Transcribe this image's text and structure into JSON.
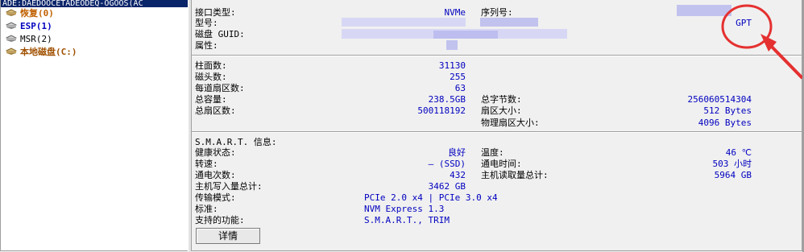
{
  "tree": {
    "top_text": "ADE:DAEDOOCETADEODEQ-OGOOS(AC",
    "items": [
      {
        "label": "恢复(0)",
        "color": "orange"
      },
      {
        "label": "ESP(1)",
        "color": "blue"
      },
      {
        "label": "MSR(2)",
        "color": "black"
      },
      {
        "label": "本地磁盘(C:)",
        "color": "brown"
      }
    ]
  },
  "info": {
    "interface_label": "接口类型:",
    "interface_value": "NVMe",
    "serial_label": "序列号:",
    "model_label": "型号:",
    "partition_style_value": "GPT",
    "guid_label": "磁盘 GUID:",
    "attr_label": "属性:",
    "cylinders_label": "柱面数:",
    "cylinders_value": "31130",
    "heads_label": "磁头数:",
    "heads_value": "255",
    "sectors_per_track_label": "每道扇区数:",
    "sectors_per_track_value": "63",
    "capacity_label": "总容量:",
    "capacity_value": "238.5GB",
    "total_bytes_label": "总字节数:",
    "total_bytes_value": "256060514304",
    "total_sectors_label": "总扇区数:",
    "total_sectors_value": "500118192",
    "sector_size_label": "扇区大小:",
    "sector_size_value": "512 Bytes",
    "physical_sector_label": "物理扇区大小:",
    "physical_sector_value": "4096 Bytes"
  },
  "smart": {
    "title": "S.M.A.R.T. 信息:",
    "health_label": "健康状态:",
    "health_value": "良好",
    "temp_label": "温度:",
    "temp_value": "46 ℃",
    "speed_label": "转速:",
    "speed_value": "— (SSD)",
    "power_on_time_label": "通电时间:",
    "power_on_time_value": "503 小时",
    "power_count_label": "通电次数:",
    "power_count_value": "432",
    "host_read_label": "主机读取量总计:",
    "host_read_value": "5964 GB",
    "host_write_label": "主机写入量总计:",
    "host_write_value": "3462 GB",
    "transfer_label": "传输模式:",
    "transfer_value": "PCIe 2.0 x4 | PCIe 3.0 x4",
    "standard_label": "标准:",
    "standard_value": "NVM Express 1.3",
    "features_label": "支持的功能:",
    "features_value": "S.M.A.R.T., TRIM"
  },
  "details_button": "详情",
  "colors": {
    "annotation": "#e53030",
    "value_text": "#0000c0",
    "selection": "#0a246a"
  }
}
